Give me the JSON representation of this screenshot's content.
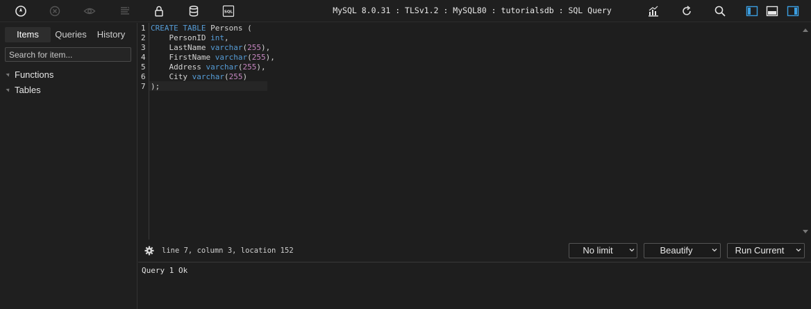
{
  "toolbar": {
    "icons": [
      "compass-icon",
      "cancel-icon",
      "eye-icon",
      "list-lines-icon",
      "lock-icon",
      "database-icon",
      "sql-icon"
    ],
    "sql_badge": "SQL",
    "connection_title": "MySQL 8.0.31 : TLSv1.2 : MySQL80 : tutorialsdb : SQL Query",
    "right_icons": [
      "chart-icon",
      "refresh-icon",
      "search-icon",
      "layout-left-icon",
      "layout-bottom-icon",
      "layout-right-icon"
    ],
    "accent": "#3b9ee0"
  },
  "sidebar": {
    "tabs": [
      {
        "label": "Items",
        "active": true
      },
      {
        "label": "Queries",
        "active": false
      },
      {
        "label": "History",
        "active": false
      }
    ],
    "search_placeholder": "Search for item...",
    "tree": [
      {
        "label": "Functions"
      },
      {
        "label": "Tables"
      }
    ]
  },
  "editor": {
    "line_numbers": [
      "1",
      "2",
      "3",
      "4",
      "5",
      "6",
      "7"
    ],
    "lines": [
      [
        {
          "t": "CREATE TABLE",
          "c": "kw"
        },
        {
          "t": " Persons (",
          "c": ""
        }
      ],
      [
        {
          "t": "    PersonID ",
          "c": ""
        },
        {
          "t": "int",
          "c": "kw"
        },
        {
          "t": ",",
          "c": ""
        }
      ],
      [
        {
          "t": "    LastName ",
          "c": ""
        },
        {
          "t": "varchar",
          "c": "kw"
        },
        {
          "t": "(",
          "c": ""
        },
        {
          "t": "255",
          "c": "num"
        },
        {
          "t": "),",
          "c": ""
        }
      ],
      [
        {
          "t": "    FirstName ",
          "c": ""
        },
        {
          "t": "varchar",
          "c": "kw"
        },
        {
          "t": "(",
          "c": ""
        },
        {
          "t": "255",
          "c": "num"
        },
        {
          "t": "),",
          "c": ""
        }
      ],
      [
        {
          "t": "    Address ",
          "c": ""
        },
        {
          "t": "varchar",
          "c": "kw"
        },
        {
          "t": "(",
          "c": ""
        },
        {
          "t": "255",
          "c": "num"
        },
        {
          "t": "),",
          "c": ""
        }
      ],
      [
        {
          "t": "    City ",
          "c": ""
        },
        {
          "t": "varchar",
          "c": "kw"
        },
        {
          "t": "(",
          "c": ""
        },
        {
          "t": "255",
          "c": "num"
        },
        {
          "t": ")",
          "c": ""
        }
      ],
      [
        {
          "t": ");",
          "c": ""
        }
      ]
    ],
    "keyword_color": "#569cd6",
    "number_color": "#c586c0"
  },
  "status": {
    "position_text": "line 7, column 3, location 152",
    "limit_label": "No limit",
    "beautify_label": "Beautify",
    "run_label": "Run Current"
  },
  "result": {
    "message": "Query 1 Ok"
  }
}
